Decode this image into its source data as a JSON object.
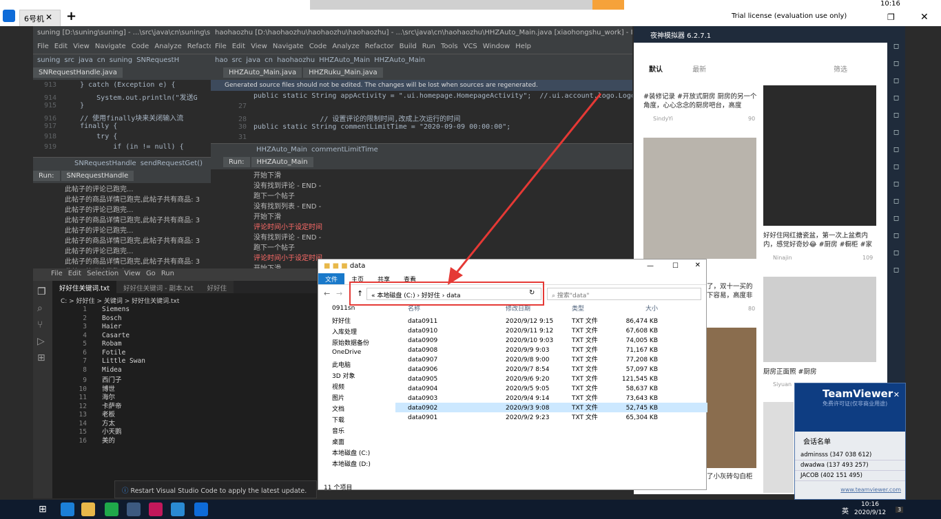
{
  "teamviewer_bar": {
    "tab_label": "6号机",
    "license": "Trial license (evaluation use only)",
    "clock_top": "10:16"
  },
  "ide_left": {
    "title": "suning [D:\\suning\\suning] - ...\\src\\java\\cn\\suning\\suning_auto\\SN",
    "menu": [
      "File",
      "Edit",
      "View",
      "Navigate",
      "Code",
      "Analyze",
      "Refactor",
      "Build",
      "Run"
    ],
    "breadcrumb": [
      "suning",
      "src",
      "java",
      "cn",
      "suning",
      "SNRequestH"
    ],
    "tab": "SNRequestHandle.java",
    "code": [
      {
        "n": "913",
        "t": "    } catch (Exception e) {"
      },
      {
        "n": "914",
        "t": "        System.out.println(\"发送G"
      },
      {
        "n": "915",
        "t": "    }"
      },
      {
        "n": "916",
        "t": "    // 使用finally块来关闭输入流"
      },
      {
        "n": "917",
        "t": "    finally {"
      },
      {
        "n": "918",
        "t": "        try {"
      },
      {
        "n": "919",
        "t": "            if (in != null) {"
      }
    ],
    "crumb_bottom": [
      "SNRequestHandle",
      "sendRequestGet()"
    ],
    "run_tab": "SNRequestHandle",
    "run_lines": [
      "此帖子的评论已跑完...",
      "此帖子的商品详情已跑完,此帖子共有商品: 3",
      "此帖子的评论已跑完...",
      "此帖子的商品详情已跑完,此帖子共有商品: 3",
      "此帖子的评论已跑完...",
      "此帖子的商品详情已跑完,此帖子共有商品: 3",
      "此帖子的评论已跑完...",
      "此帖子的商品详情已跑完,此帖子共有商品: 3",
      "此帖子的评论已跑完...",
      "此帖子的商品详情已跑完,此帖子共有商品: 3"
    ]
  },
  "ide_right": {
    "title": "haohaozhu [D:\\haohaozhu\\haohaozhu\\haohaozhu] - ...\\src\\java\\cn\\haohaozhu\\HHZAuto_Main.java [xiaohongshu_work] - IntelliJ I...",
    "menu": [
      "File",
      "Edit",
      "View",
      "Navigate",
      "Code",
      "Analyze",
      "Refactor",
      "Build",
      "Run",
      "Tools",
      "VCS",
      "Window",
      "Help"
    ],
    "breadcrumb": [
      "hao",
      "src",
      "java",
      "cn",
      "haohaozhu",
      "HHZAuto_Main"
    ],
    "run_config": "HHZAuto_Main",
    "tabs": [
      "HHZAuto_Main.java",
      "HHZRuku_Main.java"
    ],
    "warning": "Generated source files should not be edited. The changes will be lost when sources are regenerated.",
    "code": [
      {
        "n": "",
        "t": "public static String appActivity = \".ui.homepage.HomepageActivity\";  //.ui.account.logo.LogoAct"
      },
      {
        "n": "27",
        "t": ""
      },
      {
        "n": "28",
        "t": "                // 设置评论的限制时间,改成上次运行的时间"
      },
      {
        "n": "30",
        "t": "public static String commentLimitTime = \"2020-09-09 00:00:00\";"
      },
      {
        "n": "31",
        "t": ""
      }
    ],
    "crumb_bottom": [
      "HHZAuto_Main",
      "commentLimitTime"
    ],
    "run_label": "Run:",
    "run_tab": "HHZAuto_Main",
    "run_lines": [
      {
        "t": "开始下滑",
        "red": false
      },
      {
        "t": "没有找到评论 - END -",
        "red": false
      },
      {
        "t": "跑下一个帖子",
        "red": false
      },
      {
        "t": "没有找到列表 - END -",
        "red": false
      },
      {
        "t": "开始下滑",
        "red": false
      },
      {
        "t": "评论时间小于设定时间",
        "red": true
      },
      {
        "t": "没有找到评论 - END -",
        "red": false
      },
      {
        "t": "跑下一个帖子",
        "red": false
      },
      {
        "t": "评论时间小于设定时间",
        "red": true
      },
      {
        "t": "开始下滑",
        "red": false
      }
    ],
    "side_labels": [
      "Ant Build",
      "Database",
      "Maven"
    ],
    "left_labels": [
      "1: Project",
      "2: Structure",
      "2: Favorites"
    ],
    "bottom_tabs": [
      "6: TODO",
      "4: Run",
      "9: Ver"
    ],
    "status": "All files are up-to-date (48 minutes ag"
  },
  "vscode": {
    "menu": [
      "File",
      "Edit",
      "Selection",
      "View",
      "Go",
      "Run"
    ],
    "tabs": [
      "好好住关键词.txt",
      "好好住关键词 - 副本.txt",
      "好好住"
    ],
    "breadcrumb": "C: > 好好住 > 关键词 > 好好住关键词.txt",
    "lines": [
      "Siemens",
      "Bosch",
      "Haier",
      "Casarte",
      "Robam",
      "Fotile",
      "Little Swan",
      "Midea",
      "西门子",
      "博世",
      "海尔",
      "卡萨帝",
      "老板",
      "方太",
      "小天鹅",
      "美的"
    ],
    "notification": "Restart Visual Studio Code to apply the latest update."
  },
  "explorer": {
    "title": "data",
    "ribbon": [
      "文件",
      "主页",
      "共享",
      "查看"
    ],
    "path": [
      "本地磁盘 (C:)",
      "好好住",
      "data"
    ],
    "search_placeholder": "搜索\"data\"",
    "columns": [
      "名称",
      "修改日期",
      "类型",
      "大小"
    ],
    "nav": [
      "0911sn",
      "好好住",
      "入库处理",
      "原始数据备份",
      "OneDrive",
      "此电脑",
      "3D 对象",
      "视频",
      "图片",
      "文档",
      "下载",
      "音乐",
      "桌面",
      "本地磁盘 (C:)",
      "本地磁盘 (D:)"
    ],
    "files": [
      {
        "name": "data0911",
        "date": "2020/9/12 9:15",
        "type": "TXT 文件",
        "size": "86,474 KB"
      },
      {
        "name": "data0910",
        "date": "2020/9/11 9:12",
        "type": "TXT 文件",
        "size": "67,608 KB"
      },
      {
        "name": "data0909",
        "date": "2020/9/10 9:03",
        "type": "TXT 文件",
        "size": "74,005 KB"
      },
      {
        "name": "data0908",
        "date": "2020/9/9 9:03",
        "type": "TXT 文件",
        "size": "71,167 KB"
      },
      {
        "name": "data0907",
        "date": "2020/9/8 9:00",
        "type": "TXT 文件",
        "size": "77,208 KB"
      },
      {
        "name": "data0906",
        "date": "2020/9/7 8:54",
        "type": "TXT 文件",
        "size": "57,097 KB"
      },
      {
        "name": "data0905",
        "date": "2020/9/6 9:20",
        "type": "TXT 文件",
        "size": "121,545 KB"
      },
      {
        "name": "data0904",
        "date": "2020/9/5 9:05",
        "type": "TXT 文件",
        "size": "58,637 KB"
      },
      {
        "name": "data0903",
        "date": "2020/9/4 9:14",
        "type": "TXT 文件",
        "size": "73,643 KB"
      },
      {
        "name": "data0902",
        "date": "2020/9/3 9:08",
        "type": "TXT 文件",
        "size": "52,745 KB"
      },
      {
        "name": "data0901",
        "date": "2020/9/2 9:23",
        "type": "TXT 文件",
        "size": "65,304 KB"
      }
    ],
    "item_count": "11 个项目"
  },
  "emulator": {
    "title": "夜神模拟器 6.2.7.1",
    "tab_default": "默认",
    "tab_latest": "最新",
    "filter": "筛选",
    "card1_text": "#装修记录 #开放式厨房 厨房的另一个角度，心心念念的厨房吧台，高度",
    "card1_user": "SindyYi",
    "card1_likes": "90",
    "card2_text": "好好住网红搪瓷盆，第一次上盆煮内内，感觉好奇妙😂 #厨房 #橱柜 #家",
    "card2_user": "Ninajin",
    "card2_likes": "109",
    "card3_text": "了，双十一买的下容易，高度非",
    "card3_likes": "80",
    "card4_text": "厨房正面照 #厨房",
    "card4_user": "Siyuan",
    "card5_text": "了小灰砖勾白柜"
  },
  "teamviewer": {
    "title": "TeamViewer",
    "subtitle": "免费许可证(仅非商业用途)",
    "section": "会话名单",
    "sessions": [
      "adminsss (347 038 612)",
      "dwadwa (137 493 257)",
      "JACOB (402 151 495)"
    ],
    "link": "www.teamviewer.com"
  },
  "taskbar": {
    "time": "10:16",
    "date": "2020/9/12",
    "ime": "英",
    "badge": "3"
  }
}
